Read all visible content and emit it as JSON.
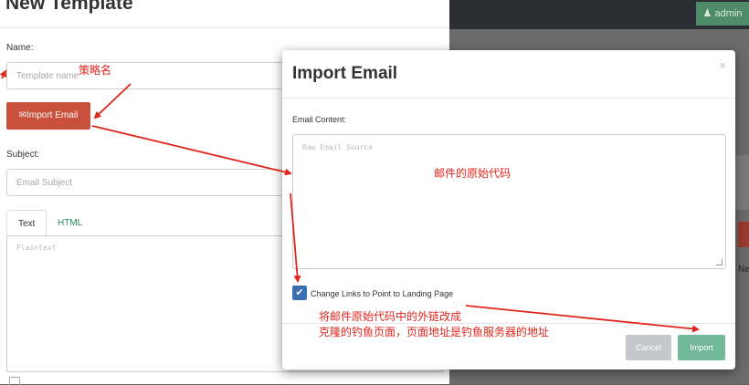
{
  "topbar": {
    "user_label": "admin",
    "user_icon": "person-icon"
  },
  "background": {
    "partial_text": "Ne"
  },
  "template_modal": {
    "title": "New Template",
    "name_label": "Name:",
    "name_placeholder": "Template name",
    "import_button_label": "Import Email",
    "import_button_icon": "envelope-icon",
    "subject_label": "Subject:",
    "subject_placeholder": "Email Subject",
    "tabs": [
      {
        "label": "Text",
        "active": true
      },
      {
        "label": "HTML",
        "active": false
      }
    ],
    "text_placeholder": "Plaintext"
  },
  "import_modal": {
    "title": "Import Email",
    "close_glyph": "×",
    "content_label": "Email Content:",
    "content_placeholder": "Raw Email Source",
    "change_links_label": "Change Links to Point to Landing Page",
    "change_links_checked": true,
    "cancel_label": "Cancel",
    "import_label": "Import"
  },
  "annotations": {
    "name_note": "策略名",
    "content_note": "邮件的原始代码",
    "links_note_line1": "将邮件原始代码中的外链改成",
    "links_note_line2": "克隆的钓鱼页面，页面地址是钓鱼服务器的地址"
  },
  "colors": {
    "annotation_red": "#e0261c",
    "import_email_button": "#c9503b",
    "import_button": "#72b99a",
    "cancel_button": "#c4c8cc",
    "checkbox": "#3b6fb0",
    "admin_badge": "#4e8c69"
  }
}
